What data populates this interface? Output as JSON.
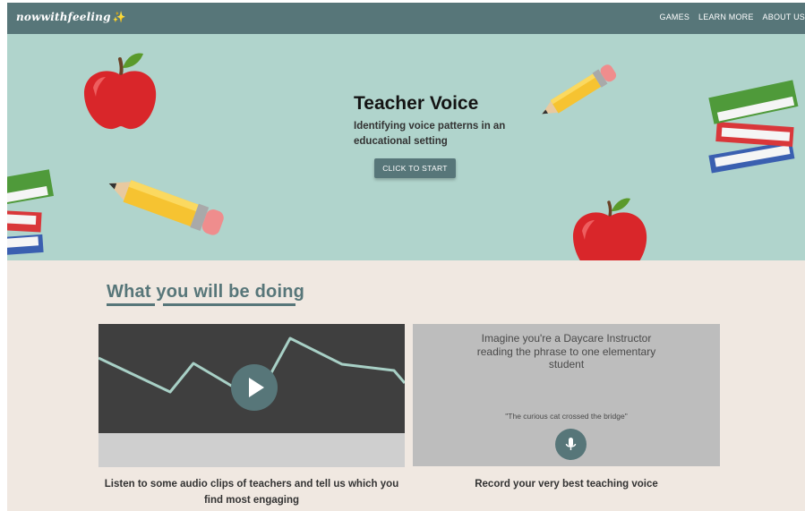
{
  "nav": {
    "brand": "nowwithfeeling",
    "brand_sparkle": "✨",
    "links": [
      "GAMES",
      "LEARN MORE",
      "ABOUT US"
    ]
  },
  "hero": {
    "title": "Teacher Voice",
    "subtitle": "Identifying voice patterns in an educational setting",
    "button_label": "CLICK TO START",
    "decorations": [
      "apple-icon",
      "pencil-icon",
      "books-icon"
    ]
  },
  "section": {
    "title": "What you will be doing"
  },
  "cards": {
    "listen": {
      "caption": "Listen to some audio clips of teachers and tell us which you find most engaging",
      "icon": "play-icon"
    },
    "record": {
      "prompt": "Imagine you're a Daycare Instructor reading the phrase to one elementary student",
      "phrase": "\"The curious cat crossed the bridge\"",
      "caption": "Record your very best teaching voice",
      "icon": "microphone-icon"
    }
  },
  "colors": {
    "nav": "#577679",
    "hero_bg": "#b0d4cc",
    "lower_bg": "#f0e8e1",
    "accent": "#577679",
    "video_bg": "#3f3f3f",
    "waveform": "#a8d0c6"
  }
}
